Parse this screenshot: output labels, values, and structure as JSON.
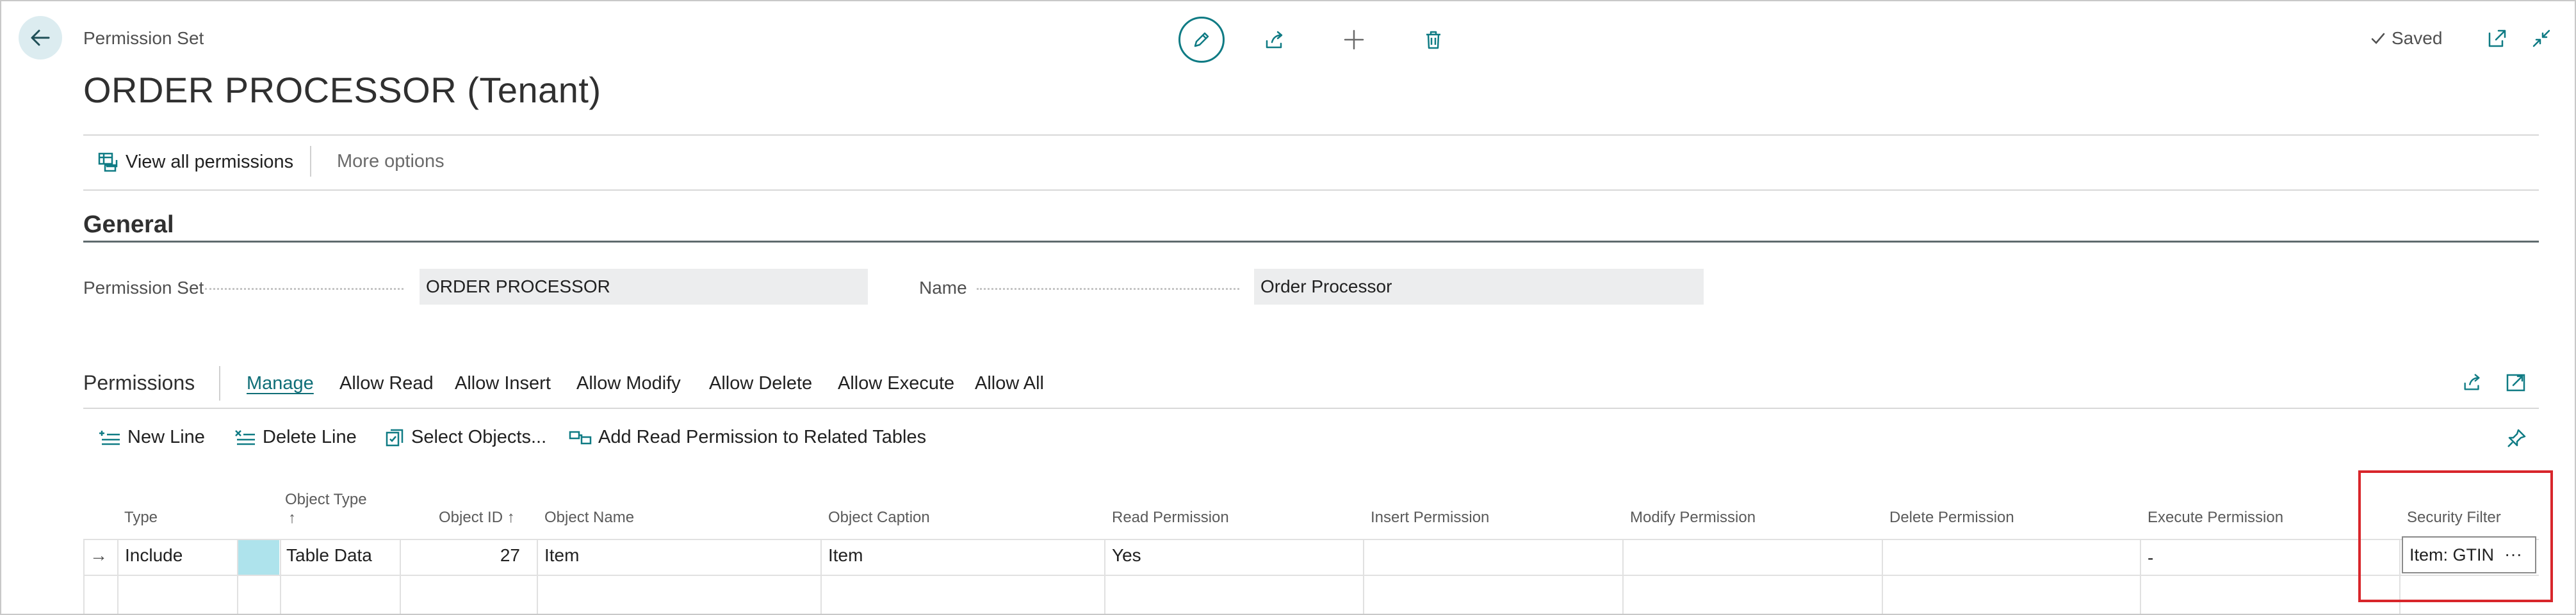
{
  "header": {
    "breadcrumb": "Permission Set",
    "title": "ORDER PROCESSOR (Tenant)",
    "saved_label": "Saved",
    "accent_color": "#0f7b84"
  },
  "action_bar": {
    "view_all_permissions": "View all permissions",
    "more_options": "More options"
  },
  "general": {
    "section_title": "General",
    "permission_set_label": "Permission Set",
    "permission_set_value": "ORDER PROCESSOR",
    "name_label": "Name",
    "name_value": "Order Processor"
  },
  "permissions": {
    "title": "Permissions",
    "actions": [
      "Manage",
      "Allow Read",
      "Allow Insert",
      "Allow Modify",
      "Allow Delete",
      "Allow Execute",
      "Allow All"
    ],
    "toolbar": {
      "new_line": "New Line",
      "delete_line": "Delete Line",
      "select_objects": "Select Objects...",
      "add_read": "Add Read Permission to Related Tables"
    },
    "columns": {
      "type": "Type",
      "object_type": "Object Type",
      "object_type_sort": "↑",
      "object_id": "Object ID",
      "object_id_sort": "↑",
      "object_name": "Object Name",
      "object_caption": "Object Caption",
      "read_permission": "Read Permission",
      "insert_permission": "Insert Permission",
      "modify_permission": "Modify Permission",
      "delete_permission": "Delete Permission",
      "execute_permission": "Execute Permission",
      "security_filter": "Security Filter"
    },
    "rows": [
      {
        "indicator": "→",
        "type": "Include",
        "object_type": "Table Data",
        "object_id": "27",
        "object_name": "Item",
        "object_caption": "Item",
        "read_permission": "Yes",
        "insert_permission": "",
        "modify_permission": "",
        "delete_permission": "",
        "execute_permission": "-",
        "security_filter": "Item: GTIN",
        "more": "···"
      }
    ]
  }
}
